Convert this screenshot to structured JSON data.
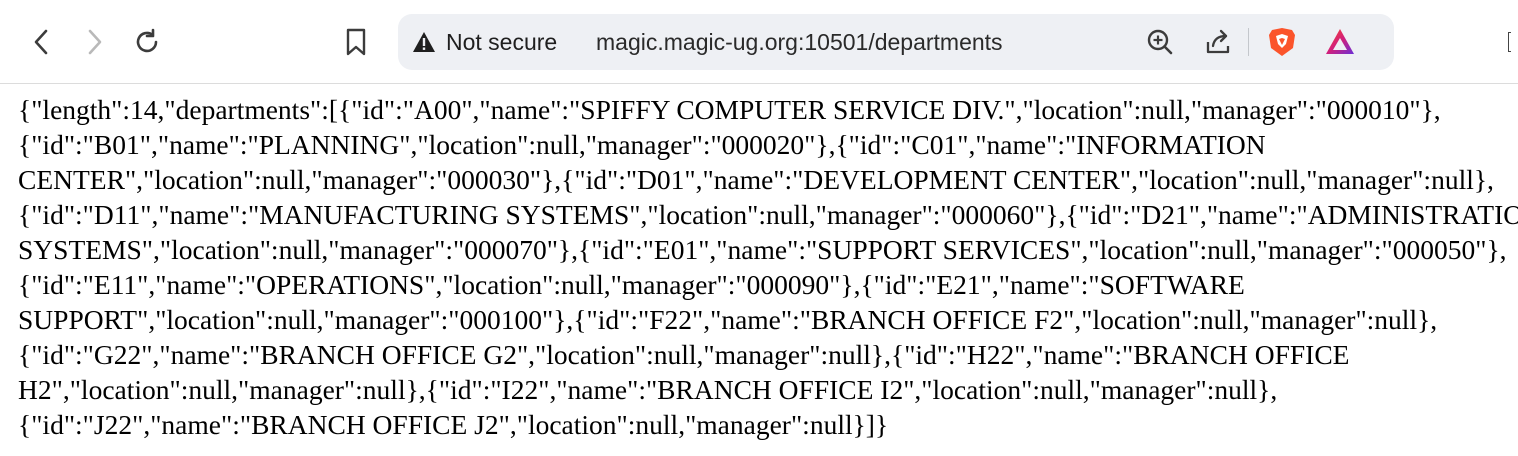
{
  "browser": {
    "security_label": "Not secure",
    "url": "magic.magic-ug.org:10501/departments",
    "icons": [
      "back-icon",
      "forward-icon",
      "reload-icon",
      "bookmark-icon",
      "warning-icon",
      "zoom-icon",
      "share-icon",
      "brave-shields-icon",
      "brave-rewards-icon"
    ]
  },
  "page": {
    "lines": [
      "{\"length\":14,\"departments\":[{\"id\":\"A00\",\"name\":\"SPIFFY COMPUTER SERVICE DIV.\",\"location\":null,\"manager\":\"000010\"},",
      "{\"id\":\"B01\",\"name\":\"PLANNING\",\"location\":null,\"manager\":\"000020\"},{\"id\":\"C01\",\"name\":\"INFORMATION",
      "CENTER\",\"location\":null,\"manager\":\"000030\"},{\"id\":\"D01\",\"name\":\"DEVELOPMENT CENTER\",\"location\":null,\"manager\":null},",
      "{\"id\":\"D11\",\"name\":\"MANUFACTURING SYSTEMS\",\"location\":null,\"manager\":\"000060\"},{\"id\":\"D21\",\"name\":\"ADMINISTRATION",
      "SYSTEMS\",\"location\":null,\"manager\":\"000070\"},{\"id\":\"E01\",\"name\":\"SUPPORT SERVICES\",\"location\":null,\"manager\":\"000050\"},",
      "{\"id\":\"E11\",\"name\":\"OPERATIONS\",\"location\":null,\"manager\":\"000090\"},{\"id\":\"E21\",\"name\":\"SOFTWARE",
      "SUPPORT\",\"location\":null,\"manager\":\"000100\"},{\"id\":\"F22\",\"name\":\"BRANCH OFFICE F2\",\"location\":null,\"manager\":null},",
      "{\"id\":\"G22\",\"name\":\"BRANCH OFFICE G2\",\"location\":null,\"manager\":null},{\"id\":\"H22\",\"name\":\"BRANCH OFFICE",
      "H2\",\"location\":null,\"manager\":null},{\"id\":\"I22\",\"name\":\"BRANCH OFFICE I2\",\"location\":null,\"manager\":null},",
      "{\"id\":\"J22\",\"name\":\"BRANCH OFFICE J2\",\"location\":null,\"manager\":null}]}"
    ]
  },
  "colors": {
    "address_bar_bg": "#eef0f4",
    "brave_orange": "#fb542b",
    "rewards_purple": "#6b2fd6"
  }
}
